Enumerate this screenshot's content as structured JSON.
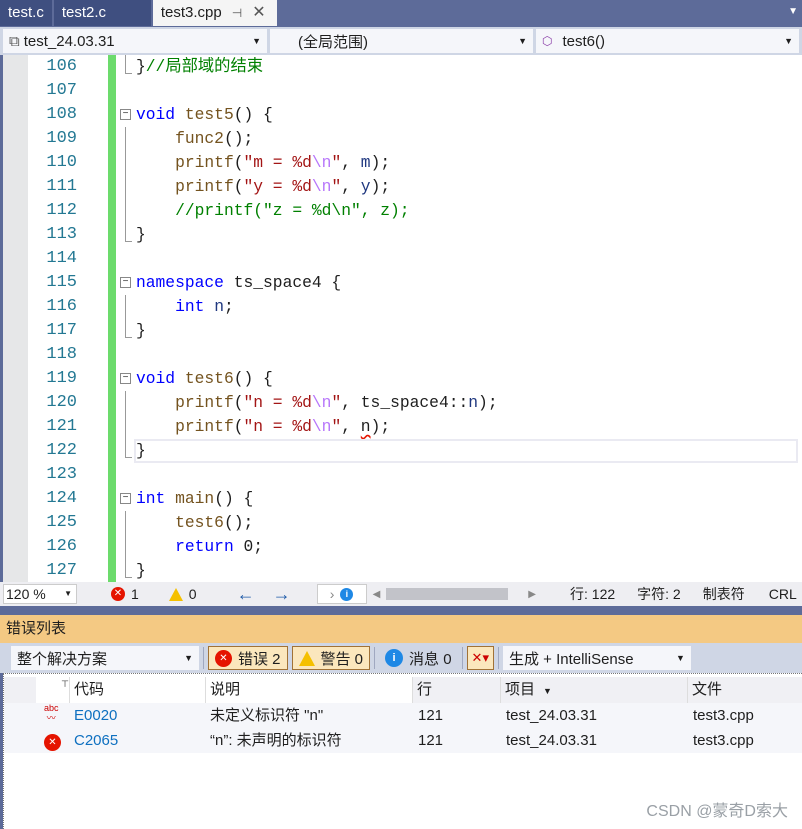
{
  "tabs": [
    {
      "label": "test.c"
    },
    {
      "label": "test2.c"
    },
    {
      "label": "test3.cpp",
      "active": true,
      "pin_icon": "pin-icon",
      "close_icon": "close-icon"
    }
  ],
  "navbar": {
    "project": "test_24.03.31",
    "scope": "(全局范围)",
    "member": "test6()"
  },
  "code_lines": [
    {
      "n": "106",
      "t": [
        [
          "}",
          "pl"
        ],
        [
          "//局部域的结束",
          "cm"
        ]
      ]
    },
    {
      "n": "107",
      "t": []
    },
    {
      "n": "108",
      "t": [
        [
          "void",
          "kw"
        ],
        [
          " ",
          "pl"
        ],
        [
          "test5",
          "fn"
        ],
        [
          "() {",
          "pl"
        ]
      ],
      "fold": true
    },
    {
      "n": "109",
      "t": [
        [
          "    ",
          "pl"
        ],
        [
          "func2",
          "fn"
        ],
        [
          "();",
          "pl"
        ]
      ]
    },
    {
      "n": "110",
      "t": [
        [
          "    ",
          "pl"
        ],
        [
          "printf",
          "fn"
        ],
        [
          "(",
          "pl"
        ],
        [
          "\"m = %d",
          "str"
        ],
        [
          "\\n",
          "esc"
        ],
        [
          "\"",
          "str"
        ],
        [
          ", ",
          "pl"
        ],
        [
          "m",
          "id"
        ],
        [
          ");",
          "pl"
        ]
      ]
    },
    {
      "n": "111",
      "t": [
        [
          "    ",
          "pl"
        ],
        [
          "printf",
          "fn"
        ],
        [
          "(",
          "pl"
        ],
        [
          "\"y = %d",
          "str"
        ],
        [
          "\\n",
          "esc"
        ],
        [
          "\"",
          "str"
        ],
        [
          ", ",
          "pl"
        ],
        [
          "y",
          "id"
        ],
        [
          ");",
          "pl"
        ]
      ]
    },
    {
      "n": "112",
      "t": [
        [
          "    ",
          "pl"
        ],
        [
          "//printf(\"z = %d\\n\", z);",
          "cm"
        ]
      ]
    },
    {
      "n": "113",
      "t": [
        [
          "}",
          "pl"
        ]
      ]
    },
    {
      "n": "114",
      "t": []
    },
    {
      "n": "115",
      "t": [
        [
          "namespace",
          "kw"
        ],
        [
          " ",
          "pl"
        ],
        [
          "ts_space4",
          "pl"
        ],
        [
          " {",
          "pl"
        ]
      ],
      "fold": true
    },
    {
      "n": "116",
      "t": [
        [
          "    ",
          "pl"
        ],
        [
          "int",
          "kw"
        ],
        [
          " ",
          "pl"
        ],
        [
          "n",
          "id"
        ],
        [
          ";",
          "pl"
        ]
      ]
    },
    {
      "n": "117",
      "t": [
        [
          "}",
          "pl"
        ]
      ]
    },
    {
      "n": "118",
      "t": []
    },
    {
      "n": "119",
      "t": [
        [
          "void",
          "kw"
        ],
        [
          " ",
          "pl"
        ],
        [
          "test6",
          "fn"
        ],
        [
          "() {",
          "pl"
        ]
      ],
      "fold": true
    },
    {
      "n": "120",
      "t": [
        [
          "    ",
          "pl"
        ],
        [
          "printf",
          "fn"
        ],
        [
          "(",
          "pl"
        ],
        [
          "\"n = %d",
          "str"
        ],
        [
          "\\n",
          "esc"
        ],
        [
          "\"",
          "str"
        ],
        [
          ", ",
          "pl"
        ],
        [
          "ts_space4",
          "pl"
        ],
        [
          "::",
          "pl"
        ],
        [
          "n",
          "id"
        ],
        [
          ");",
          "pl"
        ]
      ]
    },
    {
      "n": "121",
      "t": [
        [
          "    ",
          "pl"
        ],
        [
          "printf",
          "fn"
        ],
        [
          "(",
          "pl"
        ],
        [
          "\"n = %d",
          "str"
        ],
        [
          "\\n",
          "esc"
        ],
        [
          "\"",
          "str"
        ],
        [
          ", ",
          "pl"
        ],
        [
          "n",
          "squig"
        ],
        [
          ");",
          "pl"
        ]
      ]
    },
    {
      "n": "122",
      "t": [
        [
          "}",
          "pl"
        ]
      ],
      "current": true
    },
    {
      "n": "123",
      "t": []
    },
    {
      "n": "124",
      "t": [
        [
          "int",
          "kw"
        ],
        [
          " ",
          "pl"
        ],
        [
          "main",
          "fn"
        ],
        [
          "() {",
          "pl"
        ]
      ],
      "fold": true
    },
    {
      "n": "125",
      "t": [
        [
          "    ",
          "pl"
        ],
        [
          "test6",
          "fn"
        ],
        [
          "();",
          "pl"
        ]
      ]
    },
    {
      "n": "126",
      "t": [
        [
          "    ",
          "pl"
        ],
        [
          "return",
          "kw"
        ],
        [
          " 0;",
          "pl"
        ]
      ]
    },
    {
      "n": "127",
      "t": [
        [
          "}",
          "pl"
        ]
      ]
    }
  ],
  "status": {
    "zoom": "120 %",
    "errors": "1",
    "warnings": "0",
    "line": "行: 122",
    "char": "字符: 2",
    "tabs": "制表符",
    "eol": "CRL"
  },
  "error_list": {
    "title": "错误列表",
    "scope": "整个解决方案",
    "errors_btn": "错误 2",
    "warnings_btn": "警告 0",
    "messages_btn": "消息 0",
    "source": "生成 + IntelliSense",
    "columns": [
      "代码",
      "说明",
      "行",
      "项目",
      "文件"
    ],
    "rows": [
      {
        "icon": "spellcheck-error-icon",
        "code": "E0020",
        "desc": "未定义标识符 \"n\"",
        "line": "121",
        "project": "test_24.03.31",
        "file": "test3.cpp"
      },
      {
        "icon": "error-icon",
        "code": "C2065",
        "desc": "“n”: 未声明的标识符",
        "line": "121",
        "project": "test_24.03.31",
        "file": "test3.cpp"
      }
    ]
  },
  "watermark": "CSDN @蒙奇D索大",
  "colors": {
    "keyword": "#0000ff",
    "function": "#74531f",
    "string": "#a31515",
    "escape": "#b776fb",
    "comment": "#008000",
    "line_number": "#237893",
    "accent": "#5d6b99",
    "tool_window_title": "#f4c983"
  }
}
